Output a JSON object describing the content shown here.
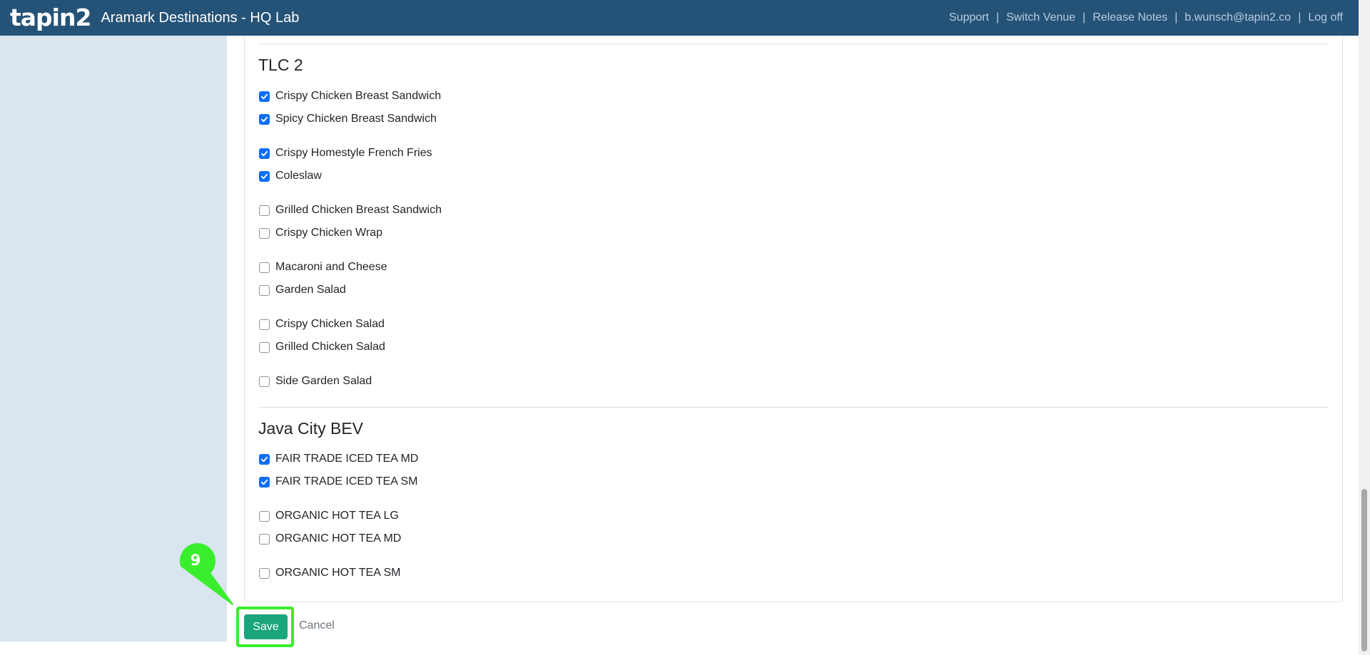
{
  "header": {
    "brand": "tapin2",
    "venue": "Aramark Destinations - HQ Lab",
    "links": {
      "support": "Support",
      "switch_venue": "Switch Venue",
      "release_notes": "Release Notes",
      "user": "b.wunsch@tapin2.co",
      "logoff": "Log off"
    },
    "separator": "|"
  },
  "sections": [
    {
      "title": "TLC 2",
      "items": [
        {
          "label": "Crispy Chicken Breast Sandwich",
          "checked": true
        },
        {
          "label": "Spicy Chicken Breast Sandwich",
          "checked": true
        },
        {
          "label": "Crispy Homestyle French Fries",
          "checked": true
        },
        {
          "label": "Coleslaw",
          "checked": true
        },
        {
          "label": "Grilled Chicken Breast Sandwich",
          "checked": false
        },
        {
          "label": "Crispy Chicken Wrap",
          "checked": false
        },
        {
          "label": "Macaroni and Cheese",
          "checked": false
        },
        {
          "label": "Garden Salad",
          "checked": false
        },
        {
          "label": "Crispy Chicken Salad",
          "checked": false
        },
        {
          "label": "Grilled Chicken Salad",
          "checked": false
        },
        {
          "label": "Side Garden Salad",
          "checked": false
        }
      ]
    },
    {
      "title": "Java City BEV",
      "items": [
        {
          "label": "FAIR TRADE ICED TEA MD",
          "checked": true
        },
        {
          "label": "FAIR TRADE ICED TEA SM",
          "checked": true
        },
        {
          "label": "ORGANIC HOT TEA LG",
          "checked": false
        },
        {
          "label": "ORGANIC HOT TEA MD",
          "checked": false
        },
        {
          "label": "ORGANIC HOT TEA SM",
          "checked": false
        }
      ]
    }
  ],
  "actions": {
    "save_label": "Save",
    "cancel_label": "Cancel"
  },
  "annotation": {
    "step_number": "9"
  },
  "colors": {
    "navbar": "#255378",
    "sidebar": "#d9e5ef",
    "checkbox_checked": "#0d6efd",
    "save_button": "#1aa57c",
    "highlight": "#39ee2c"
  }
}
